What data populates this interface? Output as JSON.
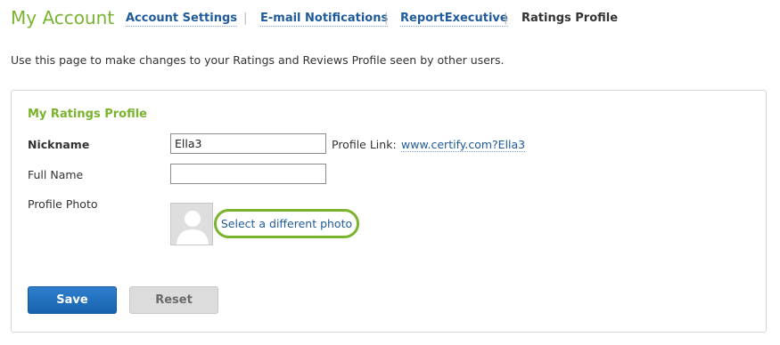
{
  "header": {
    "title": "My Account",
    "tabs": [
      {
        "label": "Account Settings"
      },
      {
        "label": "E-mail Notifications"
      },
      {
        "label": "ReportExecutive"
      },
      {
        "label": "Ratings Profile"
      }
    ]
  },
  "intro": "Use this page to make changes to your Ratings and Reviews Profile seen by other users.",
  "profile": {
    "title": "My Ratings Profile",
    "nickname_label": "Nickname",
    "nickname_value": "Ella3",
    "profile_link_label": "Profile Link:",
    "profile_link": "www.certify.com?Ella3",
    "fullname_label": "Full Name",
    "fullname_value": "",
    "photo_label": "Profile Photo",
    "select_photo": "Select a different photo"
  },
  "buttons": {
    "save": "Save",
    "reset": "Reset"
  },
  "colors": {
    "accent_green": "#7ab32e",
    "link_blue": "#1f5b9b",
    "save_blue": "#1763b0"
  }
}
